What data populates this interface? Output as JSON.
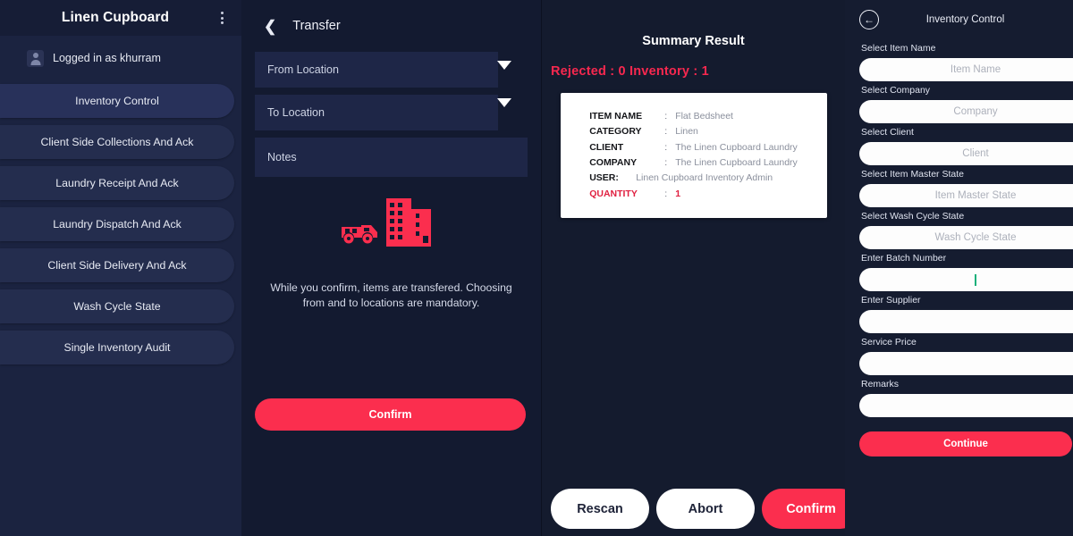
{
  "colors": {
    "accent_red": "#fb2e4e",
    "sidebar_bg": "#1b2340",
    "panel_bg": "#131a30",
    "caret_green": "#17b07a"
  },
  "sidebar": {
    "app_title": "Linen Cupboard",
    "menu_icon": "kebab-menu-icon",
    "user_icon": "avatar-icon",
    "user_text": "Logged in as  khurram",
    "items": [
      {
        "label": "Inventory Control",
        "active": true
      },
      {
        "label": "Client Side Collections And Ack",
        "active": false
      },
      {
        "label": "Laundry Receipt And Ack",
        "active": false
      },
      {
        "label": "Laundry Dispatch And Ack",
        "active": false
      },
      {
        "label": "Client Side Delivery And Ack",
        "active": false
      },
      {
        "label": "Wash Cycle State",
        "active": false
      },
      {
        "label": "Single Inventory Audit",
        "active": false
      }
    ]
  },
  "transfer": {
    "back_icon": "chevron-left-icon",
    "title": "Transfer",
    "from_location": "From Location",
    "to_location": "To Location",
    "notes": "Notes",
    "dropdown_icon": "caret-down-icon",
    "illustration_icon": "truck-and-building-icon",
    "helper_text": "While you confirm, items are transfered. Choosing from and to locations are mandatory.",
    "confirm_label": "Confirm"
  },
  "summary": {
    "title": "Summary Result",
    "counts": "Rejected : 0  Inventory : 1",
    "rejected_label": "Rejected",
    "rejected_value": "0",
    "inventory_label": "Inventory",
    "inventory_value": "1",
    "card": {
      "rows": [
        {
          "key": "ITEM NAME",
          "sep": ":",
          "value": "Flat Bedsheet"
        },
        {
          "key": "CATEGORY",
          "sep": ":",
          "value": "Linen"
        },
        {
          "key": "CLIENT",
          "sep": ":",
          "value": "The Linen Cupboard Laundry"
        },
        {
          "key": "COMPANY",
          "sep": ":",
          "value": "The Linen Cupboard Laundry"
        },
        {
          "key": "USER:",
          "sep": "",
          "value": "Linen Cupboard Inventory Admin"
        },
        {
          "key": "QUANTITY",
          "sep": ":",
          "value": "1"
        }
      ]
    },
    "actions": {
      "rescan": "Rescan",
      "abort": "Abort",
      "confirm": "Confirm"
    }
  },
  "inventory": {
    "back_icon": "back-arrow-circle-icon",
    "title": "Inventory Control",
    "fields": [
      {
        "label": "Select Item Name",
        "placeholder": "Item Name",
        "value": ""
      },
      {
        "label": "Select Company",
        "placeholder": "Company",
        "value": ""
      },
      {
        "label": "Select Client",
        "placeholder": "Client",
        "value": ""
      },
      {
        "label": "Select Item Master State",
        "placeholder": "Item Master State",
        "value": ""
      },
      {
        "label": "Select Wash Cycle State",
        "placeholder": "Wash Cycle State",
        "value": ""
      },
      {
        "label": "Enter Batch Number",
        "placeholder": "",
        "value": "",
        "focused": true
      },
      {
        "label": "Enter Supplier",
        "placeholder": "",
        "value": ""
      },
      {
        "label": "Service Price",
        "placeholder": "",
        "value": ""
      },
      {
        "label": "Remarks",
        "placeholder": "",
        "value": ""
      }
    ],
    "continue_label": "Continue"
  }
}
